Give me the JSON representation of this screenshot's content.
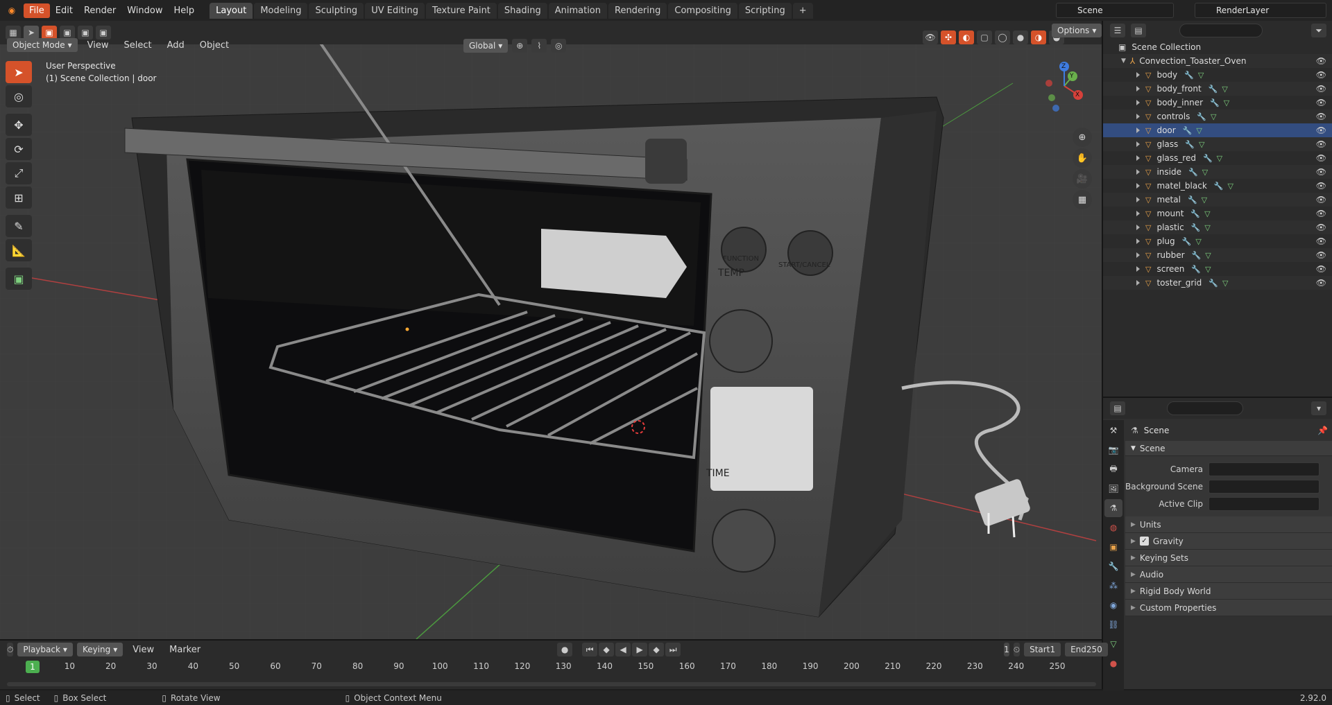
{
  "topbar": {
    "menu": [
      "File",
      "Edit",
      "Render",
      "Window",
      "Help"
    ],
    "workspaces": [
      "Layout",
      "Modeling",
      "Sculpting",
      "UV Editing",
      "Texture Paint",
      "Shading",
      "Animation",
      "Rendering",
      "Compositing",
      "Scripting"
    ],
    "active_workspace": "Layout",
    "add_tab": "+",
    "scene_name": "Scene",
    "view_layer": "RenderLayer"
  },
  "viewport_header": {
    "mode": "Object Mode",
    "menus": [
      "View",
      "Select",
      "Add",
      "Object"
    ],
    "transform_orientation": "Global",
    "options": "Options"
  },
  "viewport": {
    "view_label": "User Perspective",
    "collection_label": "(1) Scene Collection | door",
    "oven_labels": {
      "function": "FUNCTION",
      "start_cancel": "START/CANCEL",
      "temp": "TEMP",
      "time": "TIME"
    },
    "gizmo_axes": {
      "x": "X",
      "y": "Y",
      "z": "Z"
    },
    "colors": {
      "x_axis": "#d6403a",
      "y_axis": "#6ab04c",
      "z_axis": "#3f7ce0",
      "accent": "#d5522a"
    }
  },
  "outliner": {
    "root": "Scene Collection",
    "collection": "Convection_Toaster_Oven",
    "objects": [
      "body",
      "body_front",
      "body_inner",
      "controls",
      "door",
      "glass",
      "glass_red",
      "inside",
      "matel_black",
      "metal",
      "mount",
      "plastic",
      "plug",
      "rubber",
      "screen",
      "toster_grid"
    ],
    "selected": "door"
  },
  "properties": {
    "context": "Scene",
    "panel_title": "Scene",
    "fields": [
      {
        "label": "Camera",
        "value": ""
      },
      {
        "label": "Background Scene",
        "value": ""
      },
      {
        "label": "Active Clip",
        "value": ""
      }
    ],
    "subpanels": [
      "Units",
      "Gravity",
      "Keying Sets",
      "Audio",
      "Rigid Body World",
      "Custom Properties"
    ],
    "gravity_checked": true
  },
  "timeline": {
    "menus": [
      "Playback",
      "Keying",
      "View",
      "Marker"
    ],
    "current_frame": "1",
    "start_label": "Start",
    "start": "1",
    "end_label": "End",
    "end": "250",
    "ticks": [
      "10",
      "20",
      "30",
      "40",
      "50",
      "60",
      "70",
      "80",
      "90",
      "100",
      "110",
      "120",
      "130",
      "140",
      "150",
      "160",
      "170",
      "180",
      "190",
      "200",
      "210",
      "220",
      "230",
      "240",
      "250"
    ],
    "marker_label": "1"
  },
  "statusbar": {
    "select": "Select",
    "box_select": "Box Select",
    "rotate_view": "Rotate View",
    "context_menu": "Object Context Menu",
    "version": "2.92.0"
  }
}
